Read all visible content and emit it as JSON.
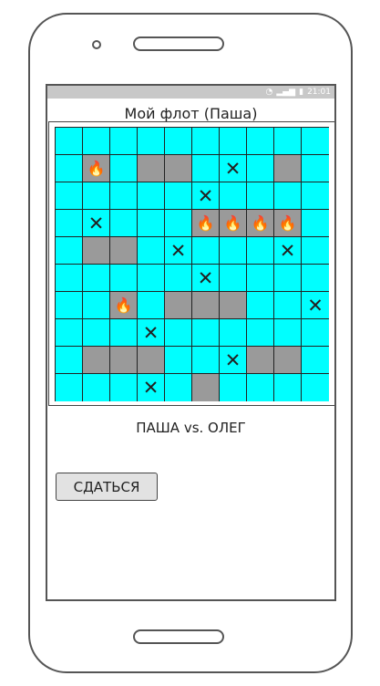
{
  "status_bar": {
    "time": "21:01",
    "icons": [
      "wifi-icon",
      "signal-icon",
      "battery-icon"
    ]
  },
  "screen": {
    "title": "Мой флот (Паша)",
    "versus": "ПАША vs. ОЛЕГ",
    "surrender_label": "СДАТЬСЯ"
  },
  "board": {
    "rows": 10,
    "cols": 10,
    "legend": {
      "empty": "water",
      "ship": "ship",
      "hit": "ship-hit",
      "miss": "miss"
    },
    "cells": [
      [
        "empty",
        "empty",
        "empty",
        "empty",
        "empty",
        "empty",
        "empty",
        "empty",
        "empty",
        "empty"
      ],
      [
        "empty",
        "hit",
        "empty",
        "ship",
        "ship",
        "empty",
        "miss",
        "empty",
        "ship",
        "empty"
      ],
      [
        "empty",
        "empty",
        "empty",
        "empty",
        "empty",
        "miss",
        "empty",
        "empty",
        "empty",
        "empty"
      ],
      [
        "empty",
        "miss",
        "empty",
        "empty",
        "empty",
        "hit",
        "hit",
        "hit",
        "hit",
        "empty"
      ],
      [
        "empty",
        "ship",
        "ship",
        "empty",
        "miss",
        "empty",
        "empty",
        "empty",
        "miss",
        "empty"
      ],
      [
        "empty",
        "empty",
        "empty",
        "empty",
        "empty",
        "miss",
        "empty",
        "empty",
        "empty",
        "empty"
      ],
      [
        "empty",
        "empty",
        "hit",
        "empty",
        "ship",
        "ship",
        "ship",
        "empty",
        "empty",
        "miss"
      ],
      [
        "empty",
        "empty",
        "empty",
        "miss",
        "empty",
        "empty",
        "empty",
        "empty",
        "empty",
        "empty"
      ],
      [
        "empty",
        "ship",
        "ship",
        "ship",
        "empty",
        "empty",
        "miss",
        "ship",
        "ship",
        "empty"
      ],
      [
        "empty",
        "empty",
        "empty",
        "miss",
        "empty",
        "ship",
        "empty",
        "empty",
        "empty",
        "empty"
      ]
    ]
  },
  "colors": {
    "water": "#00ffff",
    "ship": "#9a9a9a",
    "fire": "#e85a00",
    "grid_line": "#222222"
  },
  "glyphs": {
    "miss": "✕",
    "hit": "🔥"
  }
}
